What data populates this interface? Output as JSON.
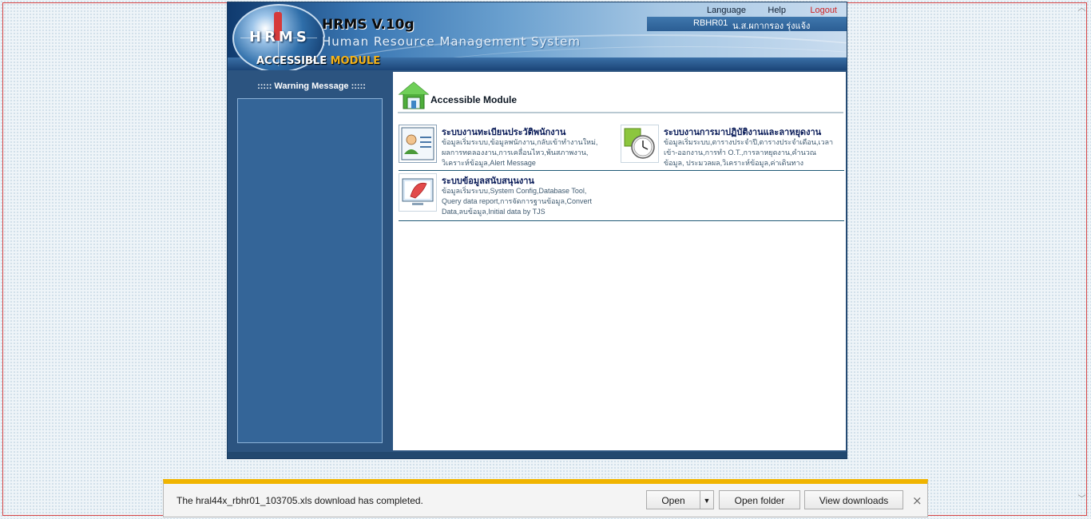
{
  "header": {
    "logo_text": "HRMS",
    "version": "HRMS V.10g",
    "system_name": "Human Resource Management System",
    "module_label_part1": "ACCESSIBLE",
    "module_label_part2": "MODULE",
    "links": {
      "language": "Language",
      "help": "Help",
      "logout": "Logout"
    },
    "user_code": "RBHR01",
    "user_name": "น.ส.ผกากรอง รุ่งแจ้ง"
  },
  "sidebar": {
    "title": "::::: Warning Message :::::"
  },
  "content": {
    "title": "Accessible Module",
    "modules": [
      {
        "title": "ระบบงานทะเบียนประวัติพนักงาน",
        "description": "ข้อมูลเริ่มระบบ,ข้อมูลพนักงาน,กลับเข้าทำงานใหม่, ผลการทดลองงาน,การเคลื่อนไหว,พ้นสภาพงาน, วิเคราะห์ข้อมูล,Alert Message",
        "icon": "employee-profile-icon"
      },
      {
        "title": "ระบบงานการมาปฏิบัติงานและลาหยุดงาน",
        "description": "ข้อมูลเริ่มระบบ,ตารางประจำปี,ตารางประจำเดือน,เวลาเข้า-ออกงาน,การทำ O.T.,การลาหยุดงาน,คำนวณข้อมูล, ประมวลผล,วิเคราะห์ข้อมูล,ค่าเดินทาง",
        "icon": "clock-icon"
      },
      {
        "title": "ระบบข้อมูลสนับสนุนงาน",
        "description": "ข้อมูลเริ่มระบบ,System Config,Database Tool, Query data report,การจัดการฐานข้อมูล,Convert Data,ลบข้อมูล,Initial data by TJS",
        "icon": "support-tools-icon"
      }
    ]
  },
  "download_bar": {
    "message": "The hral44x_rbhr01_103705.xls download has completed.",
    "open_label": "Open",
    "open_folder_label": "Open folder",
    "view_downloads_label": "View downloads",
    "close_symbol": "×"
  },
  "colors": {
    "accent_download": "#f0b400",
    "logout": "#d02525",
    "sidebar": "#346598",
    "module_title": "#081a57"
  }
}
